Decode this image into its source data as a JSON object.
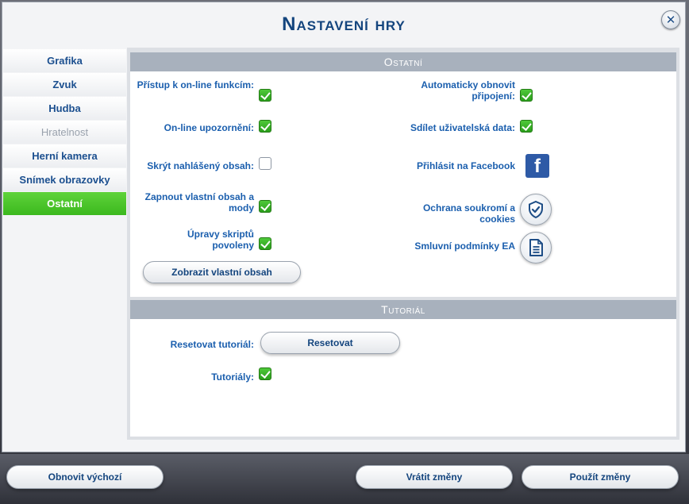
{
  "window": {
    "title": "Nastavení hry",
    "close_icon": "close-icon"
  },
  "sidebar": {
    "items": [
      {
        "label": "Grafika",
        "state": "normal"
      },
      {
        "label": "Zvuk",
        "state": "normal"
      },
      {
        "label": "Hudba",
        "state": "normal"
      },
      {
        "label": "Hratelnost",
        "state": "disabled"
      },
      {
        "label": "Herní kamera",
        "state": "normal"
      },
      {
        "label": "Snímek obrazovky",
        "state": "normal"
      },
      {
        "label": "Ostatní",
        "state": "active"
      }
    ]
  },
  "ostatni": {
    "header": "Ostatní",
    "online_access": {
      "label": "Přístup k on-line funkcím:",
      "checked": true
    },
    "online_notifications": {
      "label": "On-line upozornění:",
      "checked": true
    },
    "hide_reported": {
      "label": "Skrýt nahlášený obsah:",
      "checked": false
    },
    "custom_content": {
      "label": "Zapnout vlastní obsah a mody",
      "checked": true
    },
    "script_mods": {
      "label": "Úpravy skriptů povoleny",
      "checked": true
    },
    "show_custom_button": "Zobrazit vlastní obsah",
    "auto_reconnect": {
      "label": "Automaticky obnovit připojení:",
      "checked": true
    },
    "share_data": {
      "label": "Sdílet uživatelská data:",
      "checked": true
    },
    "facebook_label": "Přihlásit na Facebook",
    "privacy_label": "Ochrana soukromí a cookies",
    "terms_label": "Smluvní podmínky EA"
  },
  "tutorial": {
    "header": "Tutoriál",
    "reset_label": "Resetovat tutoriál:",
    "reset_button": "Resetovat",
    "tutorials": {
      "label": "Tutoriály:",
      "checked": true
    }
  },
  "footer": {
    "restore_defaults": "Obnovit výchozí",
    "revert_changes": "Vrátit změny",
    "apply_changes": "Použít změny"
  },
  "colors": {
    "accent": "#14457e",
    "active_tab": "#4cc52a",
    "check_on": "#3bb81e",
    "section_header": "#a8b1bd"
  }
}
